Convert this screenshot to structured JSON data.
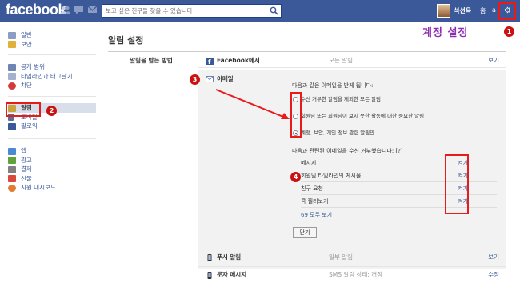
{
  "topbar": {
    "logo": "facebook",
    "search_placeholder": "보고 싶은 친구들 찾을 수 있습니다",
    "user_name": "석선옥",
    "home": "홈",
    "extra": "a",
    "gear": "⚙"
  },
  "sidebar": {
    "group1": [
      "일반",
      "보안"
    ],
    "group2": [
      "공개 범위",
      "타임라인과 태그달기",
      "차단"
    ],
    "group3": [
      "알림",
      "모바일",
      "팔로워"
    ],
    "group4": [
      "앱",
      "광고",
      "결제",
      "선물",
      "지원 대시보드"
    ]
  },
  "main": {
    "title": "알림 설정",
    "row_label": "알림을 받는 방법",
    "facebook_row": {
      "name": "Facebook에서",
      "status": "모든 알림",
      "link": "보기"
    },
    "email": {
      "name": "이메일",
      "intro": "다음과 같은 이메일을 받게 됩니다:",
      "options": [
        {
          "text": "수신 거부한 알림을 제외한 모든 알림",
          "checked": false
        },
        {
          "text": "회원님 또는 회원님이 보지 못한 활동에 대한 중요한 알림",
          "checked": false
        },
        {
          "text": "계정, 보안, 개인 정보 관련 알림만",
          "checked": true
        }
      ],
      "unsub_intro": "다음과 관련된 이메일을 수신 거부했습니다: [?]",
      "unsub_items": [
        {
          "label": "메시지",
          "link": "켜기"
        },
        {
          "label": "회원님 타임라인의 게시물",
          "link": "켜기"
        },
        {
          "label": "친구 요청",
          "link": "켜기"
        },
        {
          "label": "콕 찔러보기",
          "link": "켜기"
        }
      ],
      "all_link": "69 모두 보기",
      "close_button": "닫기"
    },
    "push_row": {
      "name": "푸시 알림",
      "status": "일부 알림",
      "link": "보기"
    },
    "sms_row": {
      "name": "문자 메시지",
      "status": "SMS 알림 상태: 꺼짐",
      "link": "수정"
    }
  },
  "annotations": {
    "heading": "계정 설정",
    "n1": "1",
    "n2": "2",
    "n3": "3",
    "n4": "4"
  },
  "colors": {
    "brand": "#3b5998",
    "annotation_red": "#e81a1a",
    "annotation_purple": "#8e2db0"
  }
}
